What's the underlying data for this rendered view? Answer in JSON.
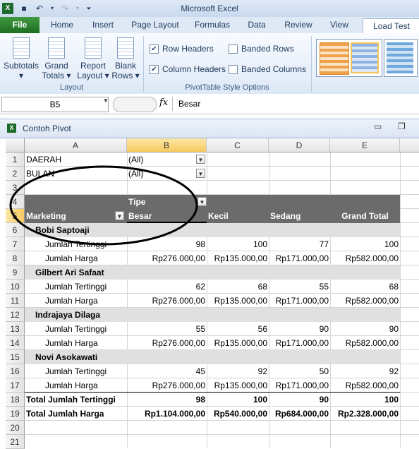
{
  "window": {
    "title": "Microsoft Excel"
  },
  "qat": {
    "save_icon": "save-icon",
    "undo_icon": "undo-icon",
    "redo_icon": "redo-icon"
  },
  "tabs": {
    "file": "File",
    "items": [
      "Home",
      "Insert",
      "Page Layout",
      "Formulas",
      "Data",
      "Review",
      "View",
      "Load Test"
    ]
  },
  "ribbon": {
    "layout_group": {
      "buttons": [
        {
          "label1": "Subtotals",
          "label2": "▾"
        },
        {
          "label1": "Grand",
          "label2": "Totals ▾"
        },
        {
          "label1": "Report",
          "label2": "Layout ▾"
        },
        {
          "label1": "Blank",
          "label2": "Rows ▾"
        }
      ],
      "label": "Layout"
    },
    "style_options_group": {
      "row_headers": {
        "label": "Row Headers",
        "checked": true
      },
      "column_headers": {
        "label": "Column Headers",
        "checked": true
      },
      "banded_rows": {
        "label": "Banded Rows",
        "checked": false
      },
      "banded_columns": {
        "label": "Banded Columns",
        "checked": false
      },
      "label": "PivotTable Style Options"
    }
  },
  "formula_bar": {
    "name_box": "B5",
    "fx": "fx",
    "value": "Besar"
  },
  "workbook": {
    "title": "Contoh Pivot"
  },
  "columns": [
    "A",
    "B",
    "C",
    "D",
    "E"
  ],
  "rows": [
    "1",
    "2",
    "3",
    "4",
    "5",
    "6",
    "7",
    "8",
    "9",
    "10",
    "11",
    "12",
    "13",
    "14",
    "15",
    "16",
    "17",
    "18",
    "19",
    "20",
    "21"
  ],
  "filters": [
    {
      "field": "DAERAH",
      "value": "(All)"
    },
    {
      "field": "BULAN",
      "value": "(All)"
    }
  ],
  "pivot_header": {
    "col_field": "Tipe",
    "row_field": "Marketing",
    "col_items": [
      "Besar",
      "Kecil",
      "Sedang",
      "Grand Total"
    ]
  },
  "pivot_rows": [
    {
      "type": "group",
      "label": "Bobi Saptoaji"
    },
    {
      "type": "data",
      "label": "Jumlah Tertinggi",
      "values": [
        "98",
        "100",
        "77",
        "100"
      ]
    },
    {
      "type": "data",
      "label": "Jumlah Harga",
      "values": [
        "Rp276.000,00",
        "Rp135.000,00",
        "Rp171.000,00",
        "Rp582.000,00"
      ]
    },
    {
      "type": "group",
      "label": "Gilbert Ari Safaat"
    },
    {
      "type": "data",
      "label": "Jumlah Tertinggi",
      "values": [
        "62",
        "68",
        "55",
        "68"
      ]
    },
    {
      "type": "data",
      "label": "Jumlah Harga",
      "values": [
        "Rp276.000,00",
        "Rp135.000,00",
        "Rp171.000,00",
        "Rp582.000,00"
      ]
    },
    {
      "type": "group",
      "label": "Indrajaya Dilaga"
    },
    {
      "type": "data",
      "label": "Jumlah Tertinggi",
      "values": [
        "55",
        "56",
        "90",
        "90"
      ]
    },
    {
      "type": "data",
      "label": "Jumlah Harga",
      "values": [
        "Rp276.000,00",
        "Rp135.000,00",
        "Rp171.000,00",
        "Rp582.000,00"
      ]
    },
    {
      "type": "group",
      "label": "Novi Asokawati"
    },
    {
      "type": "data",
      "label": "Jumlah Tertinggi",
      "values": [
        "45",
        "92",
        "50",
        "92"
      ]
    },
    {
      "type": "data",
      "label": "Jumlah Harga",
      "values": [
        "Rp276.000,00",
        "Rp135.000,00",
        "Rp171.000,00",
        "Rp582.000,00"
      ]
    },
    {
      "type": "total",
      "label": "Total Jumlah Tertinggi",
      "values": [
        "98",
        "100",
        "90",
        "100"
      ]
    },
    {
      "type": "total",
      "label": "Total Jumlah Harga",
      "values": [
        "Rp1.104.000,00",
        "Rp540.000,00",
        "Rp684.000,00",
        "Rp2.328.000,00"
      ]
    }
  ],
  "colors": {
    "header_band": "#6b6b6b",
    "group_band": "#e0e0e0",
    "selection": "#f6c95e",
    "file_tab": "#2e7d32"
  }
}
